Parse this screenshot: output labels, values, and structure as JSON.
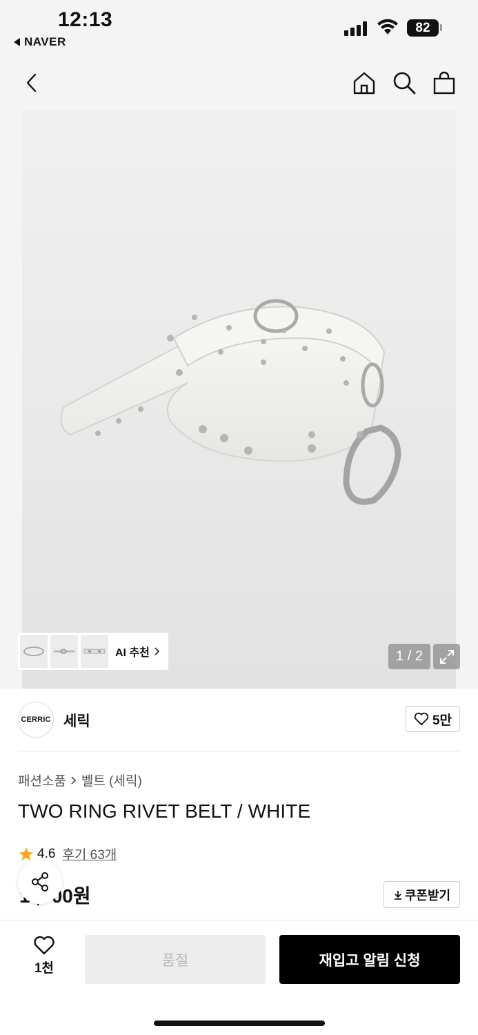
{
  "status_bar": {
    "time": "12:13",
    "back_app": "NAVER",
    "battery": "82"
  },
  "nav": {
    "icons": [
      "chevron-left-icon",
      "home-icon",
      "search-icon",
      "bag-icon"
    ]
  },
  "gallery": {
    "ai_label": "AI 추천",
    "counter": "1 / 2"
  },
  "brand": {
    "logo_text": "CERRIC",
    "name": "세릭",
    "likes": "5만"
  },
  "breadcrumb": {
    "category": "패션소품",
    "subcategory": "벨트 (세릭)"
  },
  "product": {
    "title": "TWO RING RIVET BELT / WHITE",
    "rating": "4.6",
    "reviews": "후기 63개",
    "price": "1 ,000원",
    "coupon": "쿠폰받기"
  },
  "bottom": {
    "wish_count": "1천",
    "soldout_label": "품절",
    "restock_label": "재입고 알림 신청"
  },
  "colors": {
    "accent_star": "#f5a623",
    "primary_button": "#000000",
    "disabled_button": "#ededed"
  }
}
